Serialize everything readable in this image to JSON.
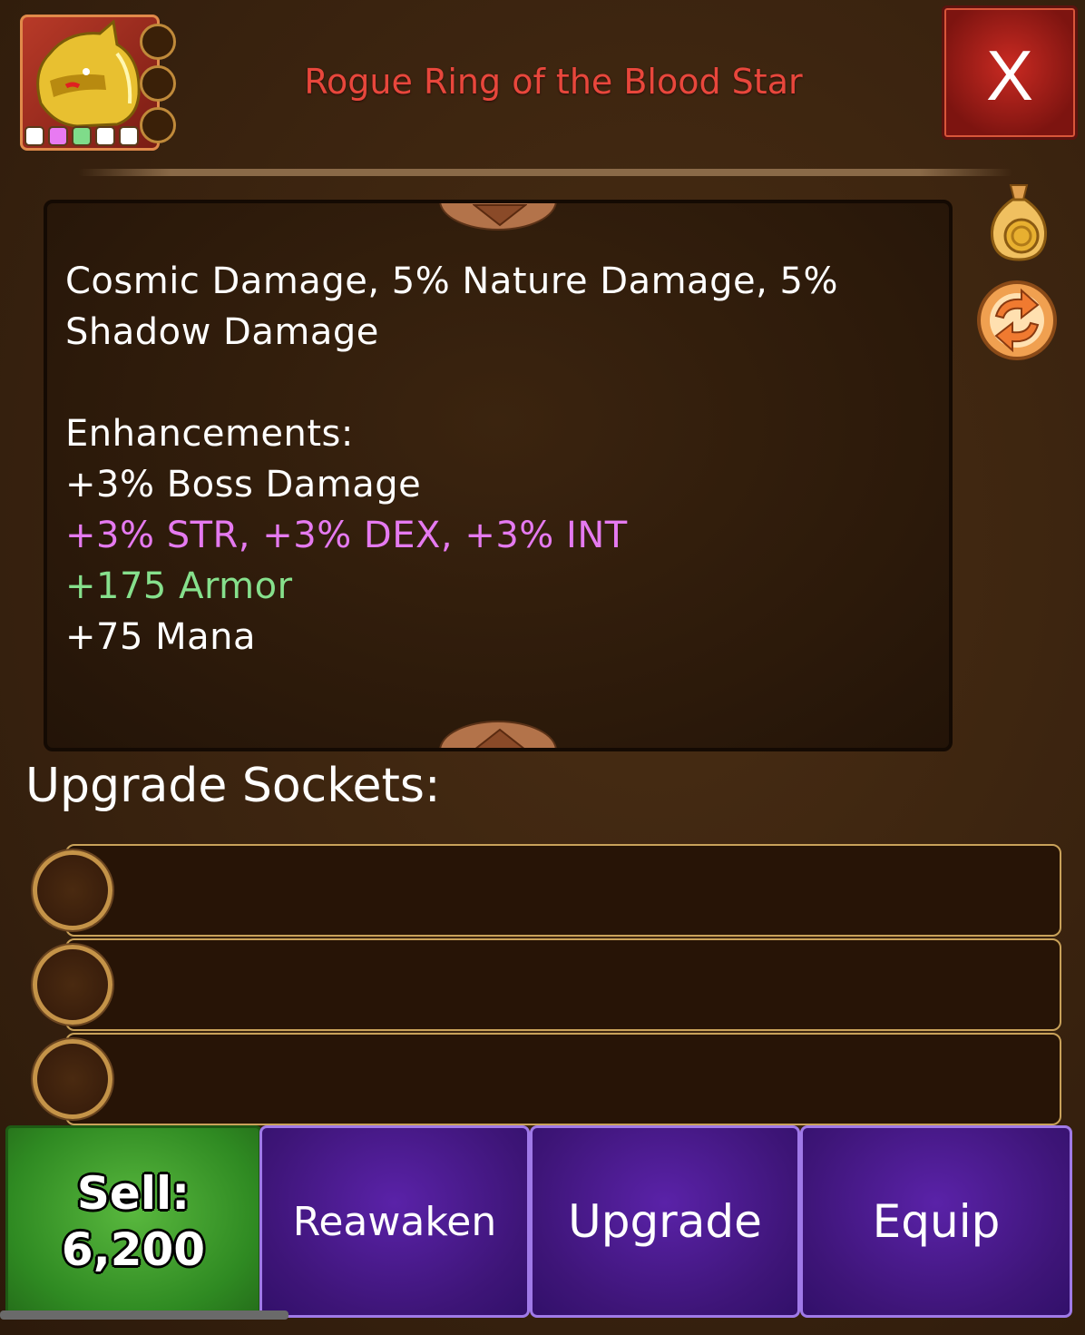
{
  "header": {
    "title": "Rogue Ring of the Blood Star",
    "close_label": "X",
    "item_icon": "golden-helmet-icon",
    "tier_colors": [
      "#ffffff",
      "#e87af2",
      "#7fdc8a",
      "#ffffff",
      "#ffffff"
    ]
  },
  "side_icons": [
    "gold-bag-icon",
    "swap-arrows-icon"
  ],
  "description": {
    "lines": [
      "Cosmic Damage, 5% Nature Damage, 5%",
      "Shadow Damage",
      "",
      "Enhancements:",
      "+3% Boss Damage",
      "+3% STR, +3% DEX, +3% INT",
      "+175 Armor",
      "+75 Mana"
    ]
  },
  "sockets": {
    "label": "Upgrade Sockets:",
    "slots": [
      "",
      "",
      ""
    ]
  },
  "actions": {
    "sell_label": "Sell:",
    "sell_value": "6,200",
    "reawaken_label": "Reawaken",
    "upgrade_label": "Upgrade",
    "equip_label": "Equip"
  },
  "colors": {
    "title": "#e8473c",
    "stat_pink": "#e57af0",
    "stat_green": "#86e08c",
    "button_purple": "#4a1a8c",
    "button_green": "#3f9a2c"
  }
}
